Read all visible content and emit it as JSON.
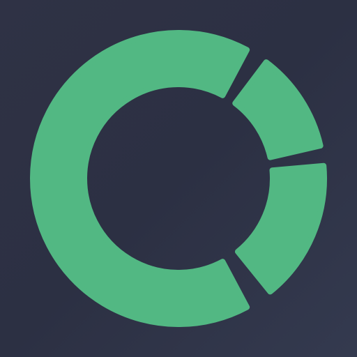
{
  "colors": {
    "background": "#2f3245",
    "ring": "#52b883"
  },
  "logo": {
    "icon": "segmented-ring-logo-icon",
    "segments": [
      {
        "name": "main-arc"
      },
      {
        "name": "upper-right-arc"
      },
      {
        "name": "lower-right-arc"
      }
    ]
  }
}
